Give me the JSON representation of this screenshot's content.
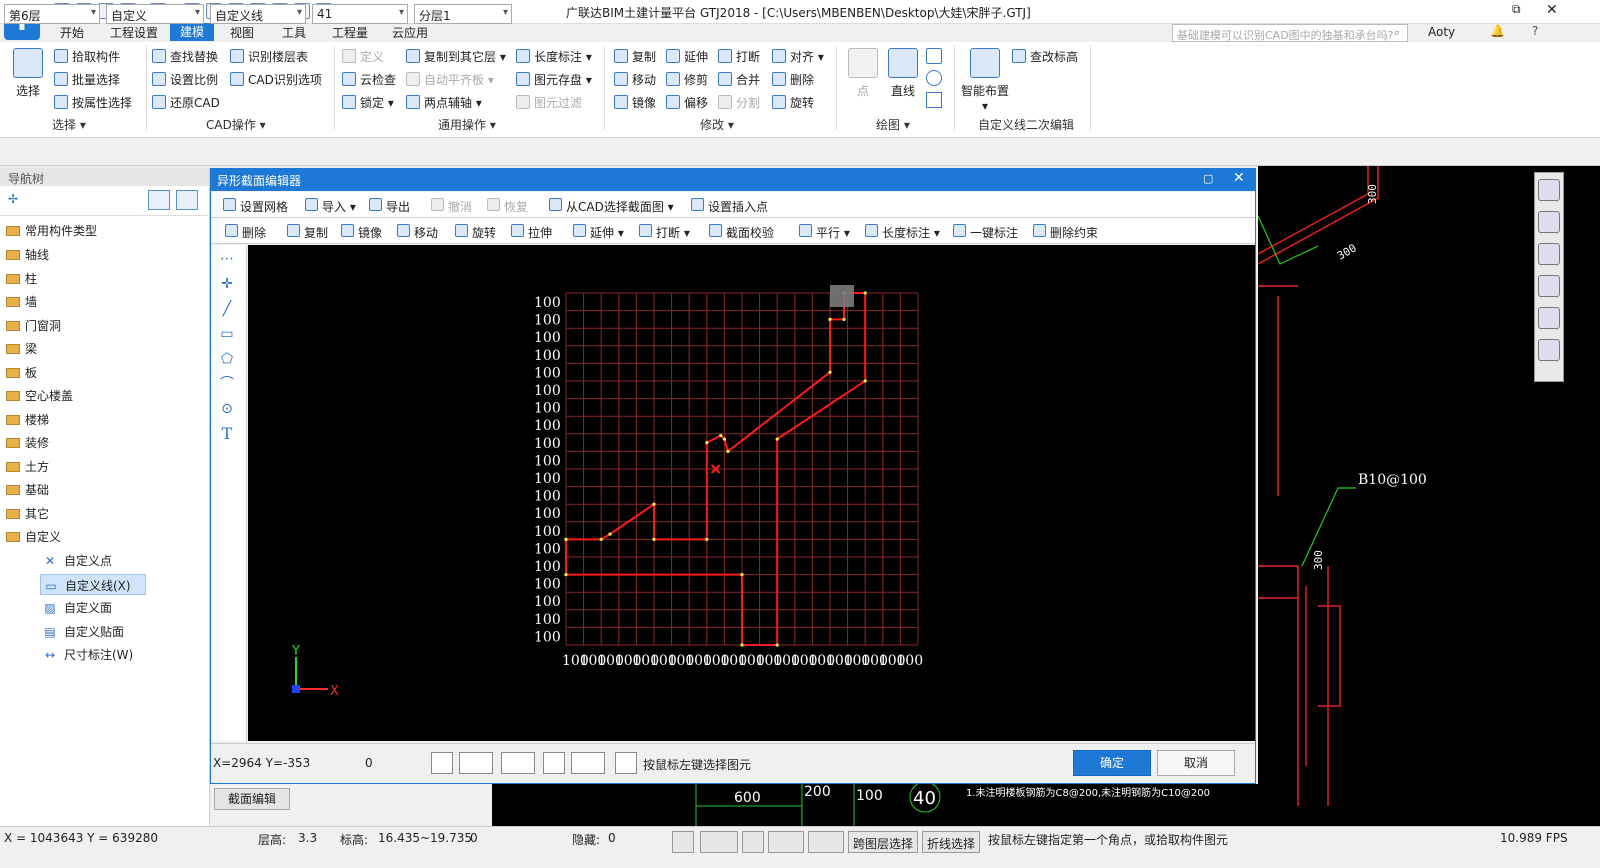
{
  "app": {
    "logo": "T",
    "title": "广联达BIM土建计量平台 GTJ2018 - [C:\\Users\\MBENBEN\\Desktop\\大娃\\宋胖子.GTJ]",
    "user": "Aoty",
    "search_placeholder": "基础建模可以识别CAD图中的独基和承台吗?"
  },
  "menu": {
    "items": [
      "开始",
      "工程设置",
      "建模",
      "视图",
      "工具",
      "工程量",
      "云应用"
    ],
    "active": "建模"
  },
  "ribbon": {
    "select": {
      "big": "选择",
      "b1": "拾取构件",
      "b2": "批量选择",
      "b3": "按属性选择",
      "group": "选择"
    },
    "cad": {
      "b1": "查找替换",
      "b2": "设置比例",
      "b3": "还原CAD",
      "b4": "识别楼层表",
      "b5": "CAD识别选项",
      "group": "CAD操作"
    },
    "common": {
      "b1": "定义",
      "b2": "云检查",
      "b3": "锁定",
      "b4": "复制到其它层",
      "b5": "自动平齐板",
      "b6": "两点辅轴",
      "b7": "长度标注",
      "b8": "图元存盘",
      "b9": "图元过滤",
      "group": "通用操作"
    },
    "modify": {
      "b1": "复制",
      "b2": "移动",
      "b3": "镜像",
      "b4": "延伸",
      "b5": "修剪",
      "b6": "偏移",
      "b7": "打断",
      "b8": "合并",
      "b9": "分割",
      "b10": "对齐",
      "b11": "删除",
      "b12": "旋转",
      "group": "修改"
    },
    "draw": {
      "b1": "点",
      "b2": "直线",
      "group": "绘图"
    },
    "custom": {
      "big": "智能布置",
      "b1": "查改标高",
      "group": "自定义线二次编辑"
    }
  },
  "combos": [
    "第6层",
    "自定义",
    "自定义线",
    "41",
    "分层1"
  ],
  "nav": {
    "title": "导航树",
    "items": [
      "常用构件类型",
      "轴线",
      "柱",
      "墙",
      "门窗洞",
      "梁",
      "板",
      "空心楼盖",
      "楼梯",
      "装修",
      "土方",
      "基础",
      "其它",
      "自定义"
    ],
    "sub": [
      "自定义点",
      "自定义线(X)",
      "自定义面",
      "自定义贴面",
      "尺寸标注(W)"
    ]
  },
  "dialog": {
    "title": "异形截面编辑器",
    "tb1": [
      "设置网格",
      "导入",
      "导出",
      "撤消",
      "恢复",
      "从CAD选择截面图",
      "设置插入点"
    ],
    "tb2": [
      "删除",
      "复制",
      "镜像",
      "移动",
      "旋转",
      "拉伸",
      "延伸",
      "打断",
      "截面校验",
      "平行",
      "长度标注",
      "一键标注",
      "删除约束"
    ],
    "coords": "X=2964 Y=-353",
    "zero": "0",
    "hint": "按鼠标左键选择图元",
    "ok": "确定",
    "cancel": "取消",
    "grid_label": "100",
    "axis_x": "X",
    "axis_y": "Y"
  },
  "cad_labels": {
    "l300a": "300",
    "l300b": "300",
    "l300c": "300",
    "b10": "B10@100",
    "l600": "600",
    "l200": "200",
    "l100": "100",
    "c40": "40",
    "note": "1.未注明楼板钢筋为C8@200,未注明钢筋为C10@200"
  },
  "tab": "截面编辑",
  "status": {
    "xy": "X = 1043643 Y = 639280",
    "floor_h_label": "层高:",
    "floor_h": "3.3",
    "elev_label": "标高:",
    "elev": "16.435~19.735",
    "elev_zero": "0",
    "hidden_label": "隐藏:",
    "hidden": "0",
    "cross": "跨图层选择",
    "poly": "折线选择",
    "hint": "按鼠标左键指定第一个角点，或拾取构件图元",
    "fps": "10.989 FPS"
  }
}
